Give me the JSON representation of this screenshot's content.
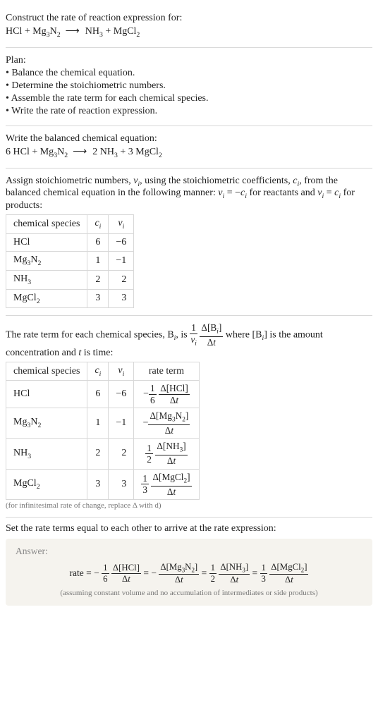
{
  "problem": {
    "title": "Construct the rate of reaction expression for:",
    "equation": "HCl + Mg₃N₂  ⟶  NH₃ + MgCl₂"
  },
  "plan": {
    "heading": "Plan:",
    "items": [
      "• Balance the chemical equation.",
      "• Determine the stoichiometric numbers.",
      "• Assemble the rate term for each chemical species.",
      "• Write the rate of reaction expression."
    ]
  },
  "balanced": {
    "heading": "Write the balanced chemical equation:",
    "equation": "6 HCl + Mg₃N₂  ⟶  2 NH₃ + 3 MgCl₂"
  },
  "stoich_intro": "Assign stoichiometric numbers, νᵢ, using the stoichiometric coefficients, cᵢ, from the balanced chemical equation in the following manner: νᵢ = −cᵢ for reactants and νᵢ = cᵢ for products:",
  "stoich_table": {
    "headers": [
      "chemical species",
      "cᵢ",
      "νᵢ"
    ],
    "rows": [
      [
        "HCl",
        "6",
        "−6"
      ],
      [
        "Mg₃N₂",
        "1",
        "−1"
      ],
      [
        "NH₃",
        "2",
        "2"
      ],
      [
        "MgCl₂",
        "3",
        "3"
      ]
    ]
  },
  "rate_term_intro": "The rate term for each chemical species, Bᵢ, is  (1/νᵢ)(Δ[Bᵢ]/Δt)  where [Bᵢ] is the amount concentration and t is time:",
  "rate_term_table": {
    "headers": [
      "chemical species",
      "cᵢ",
      "νᵢ",
      "rate term"
    ],
    "rows": [
      {
        "species": "HCl",
        "c": "6",
        "nu": "−6",
        "coef_num": "1",
        "coef_den": "6",
        "delta": "Δ[HCl]",
        "sign": "−"
      },
      {
        "species": "Mg₃N₂",
        "c": "1",
        "nu": "−1",
        "coef_num": "",
        "coef_den": "",
        "delta": "Δ[Mg₃N₂]",
        "sign": "−"
      },
      {
        "species": "NH₃",
        "c": "2",
        "nu": "2",
        "coef_num": "1",
        "coef_den": "2",
        "delta": "Δ[NH₃]",
        "sign": ""
      },
      {
        "species": "MgCl₂",
        "c": "3",
        "nu": "3",
        "coef_num": "1",
        "coef_den": "3",
        "delta": "Δ[MgCl₂]",
        "sign": ""
      }
    ],
    "note": "(for infinitesimal rate of change, replace Δ with d)"
  },
  "final_heading": "Set the rate terms equal to each other to arrive at the rate expression:",
  "answer": {
    "label": "Answer:",
    "prefix": "rate =",
    "terms": [
      {
        "sign": "−",
        "coef_num": "1",
        "coef_den": "6",
        "delta": "Δ[HCl]"
      },
      {
        "sign": "−",
        "coef_num": "",
        "coef_den": "",
        "delta": "Δ[Mg₃N₂]"
      },
      {
        "sign": "",
        "coef_num": "1",
        "coef_den": "2",
        "delta": "Δ[NH₃]"
      },
      {
        "sign": "",
        "coef_num": "1",
        "coef_den": "3",
        "delta": "Δ[MgCl₂]"
      }
    ],
    "assumptions": "(assuming constant volume and no accumulation of intermediates or side products)"
  },
  "chart_data": {
    "type": "table",
    "title": "Stoichiometric data for HCl + Mg3N2 → NH3 + MgCl2",
    "species": [
      "HCl",
      "Mg3N2",
      "NH3",
      "MgCl2"
    ],
    "c_i": [
      6,
      1,
      2,
      3
    ],
    "nu_i": [
      -6,
      -1,
      2,
      3
    ],
    "rate_expression": "rate = -(1/6) d[HCl]/dt = - d[Mg3N2]/dt = (1/2) d[NH3]/dt = (1/3) d[MgCl2]/dt"
  }
}
